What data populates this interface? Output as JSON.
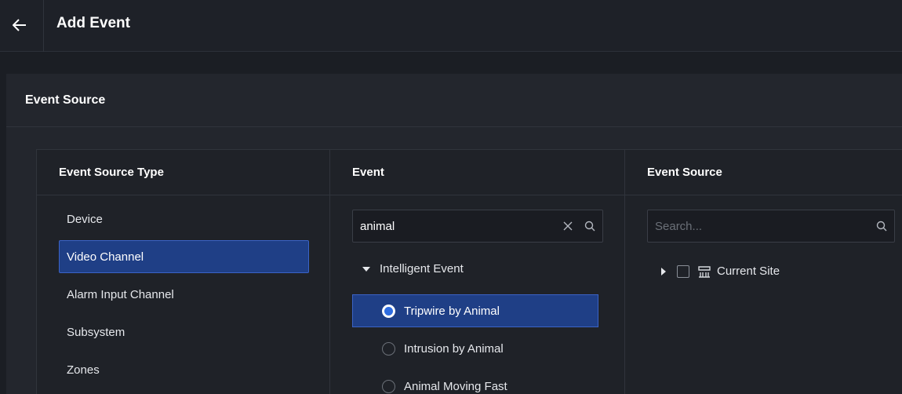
{
  "header": {
    "title": "Add Event",
    "back_icon": "arrow-left-icon"
  },
  "section": {
    "title": "Event Source"
  },
  "columns": {
    "source_type": {
      "title": "Event Source Type",
      "items": [
        {
          "label": "Device",
          "selected": false
        },
        {
          "label": "Video Channel",
          "selected": true
        },
        {
          "label": "Alarm Input Channel",
          "selected": false
        },
        {
          "label": "Subsystem",
          "selected": false
        },
        {
          "label": "Zones",
          "selected": false
        }
      ]
    },
    "event": {
      "title": "Event",
      "search": {
        "value": "animal"
      },
      "group": "Intelligent Event",
      "items": [
        {
          "label": "Tripwire by Animal",
          "selected": true
        },
        {
          "label": "Intrusion by Animal",
          "selected": false
        },
        {
          "label": "Animal Moving Fast",
          "selected": false
        }
      ]
    },
    "source": {
      "title": "Event Source",
      "search": {
        "placeholder": "Search..."
      },
      "tree": {
        "label": "Current Site"
      }
    }
  },
  "colors": {
    "accent": "#2f6de0",
    "selected_bg": "#1f3f86",
    "background": "#1b1e24"
  }
}
